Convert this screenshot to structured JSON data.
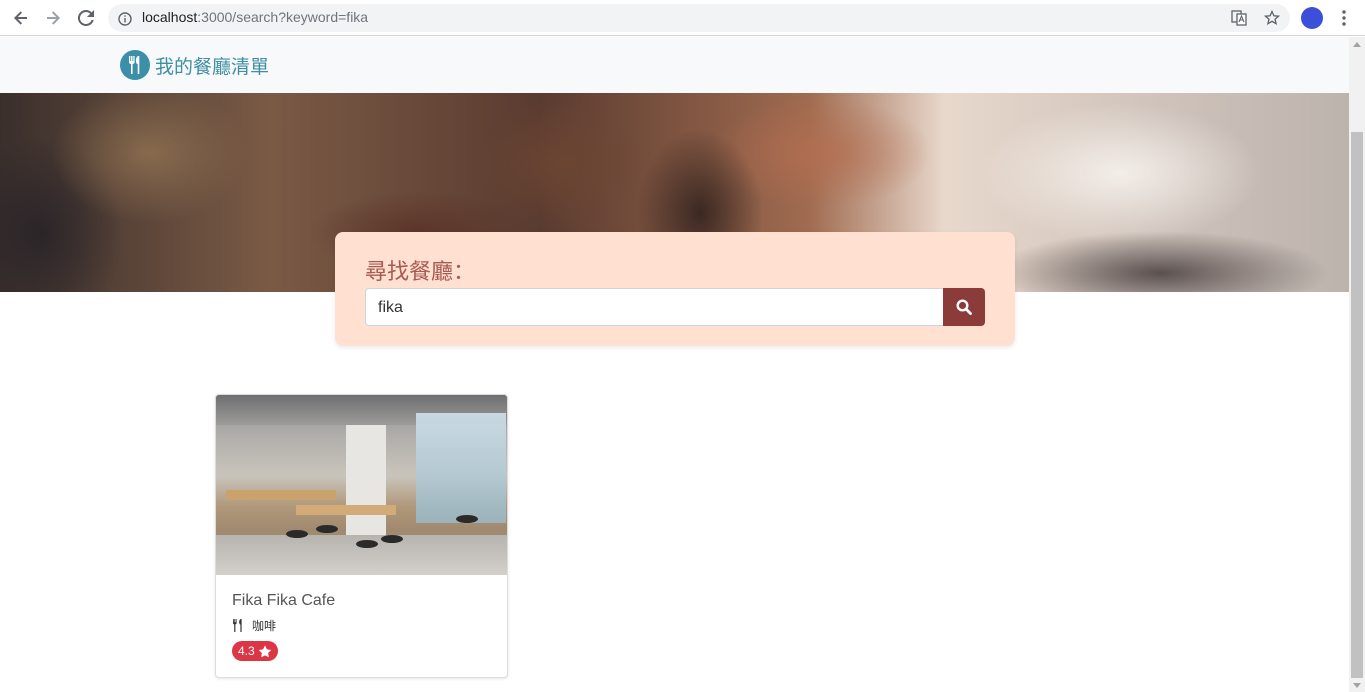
{
  "browser": {
    "url_host": "localhost",
    "url_rest": ":3000/search?keyword=fika"
  },
  "navbar": {
    "brand_title": "我的餐廳清單"
  },
  "search": {
    "label": "尋找餐廳：",
    "value": "fika"
  },
  "restaurants": [
    {
      "name": "Fika Fika Cafe",
      "category": "咖啡",
      "rating": "4.3"
    }
  ],
  "colors": {
    "brand": "#3d8fa3",
    "search_bg": "#ffe0d1",
    "search_button": "#8c3b3b",
    "rating_badge": "#dc3545"
  }
}
